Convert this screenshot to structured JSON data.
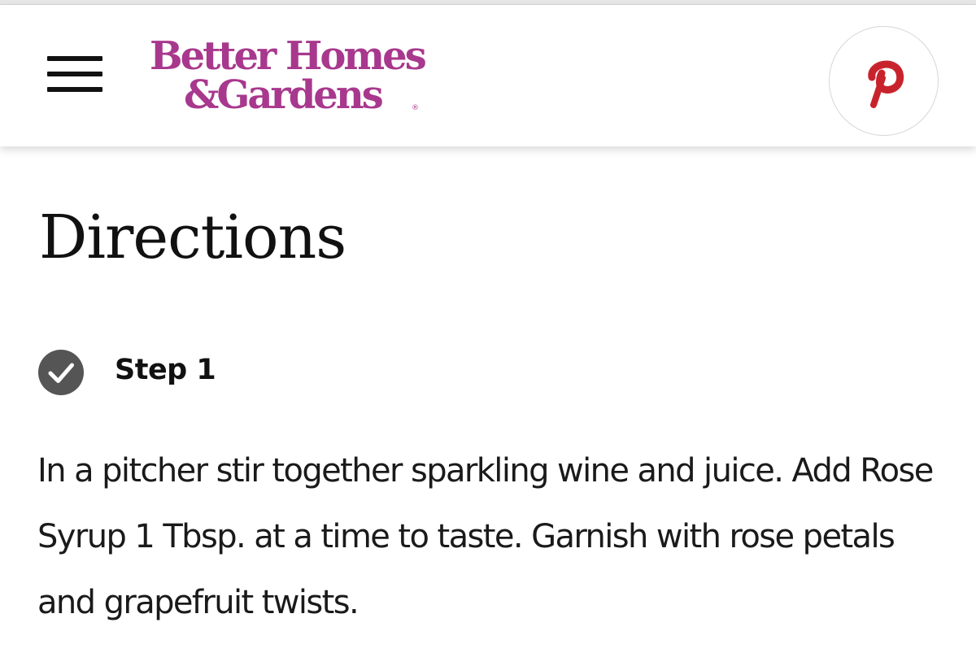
{
  "header": {
    "logo": {
      "line1": "Better Homes",
      "line2": "&Gardens",
      "registered": "®",
      "color": "#a8388d"
    },
    "menu_icon": "hamburger-menu-icon",
    "pin_icon": "pinterest-icon",
    "pin_color": "#c8232c"
  },
  "main": {
    "title": "Directions",
    "steps": [
      {
        "check_icon": "check-circle-icon",
        "check_color": "#555555",
        "label": "Step 1",
        "text": "In a pitcher stir together sparkling wine and juice. Add Rose Syrup 1 Tbsp. at a time to taste. Garnish with rose petals and grapefruit twists."
      }
    ]
  }
}
